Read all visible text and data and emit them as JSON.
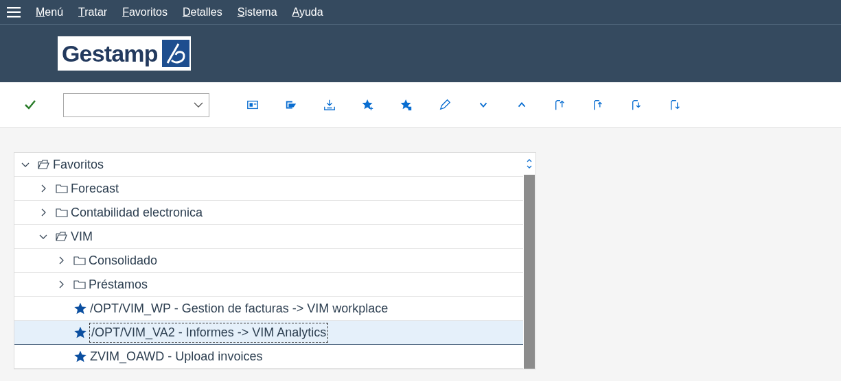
{
  "menu_bar": {
    "items": [
      {
        "label": "Menú"
      },
      {
        "label": "Tratar"
      },
      {
        "label": "Favoritos"
      },
      {
        "label": "Detalles"
      },
      {
        "label": "Sistema"
      },
      {
        "label": "Ayuda"
      }
    ]
  },
  "logo": {
    "text": "Gestamp"
  },
  "tree": [
    {
      "label": "Favoritos",
      "kind": "folder",
      "expanded": true,
      "selected": false,
      "children": [
        {
          "label": "Forecast",
          "kind": "folder",
          "expanded": false,
          "selected": false
        },
        {
          "label": "Contabilidad electronica",
          "kind": "folder",
          "expanded": false,
          "selected": false
        },
        {
          "label": "VIM",
          "kind": "folder",
          "expanded": true,
          "selected": false,
          "children": [
            {
              "label": "Consolidado",
              "kind": "folder",
              "expanded": false,
              "selected": false
            },
            {
              "label": "Préstamos",
              "kind": "folder",
              "expanded": false,
              "selected": false
            },
            {
              "label": "/OPT/VIM_WP - Gestion de facturas -> VIM workplace",
              "kind": "favorite",
              "selected": false
            },
            {
              "label": "/OPT/VIM_VA2 - Informes -> VIM Analytics",
              "kind": "favorite",
              "selected": true
            },
            {
              "label": "ZVIM_OAWD - Upload invoices",
              "kind": "favorite",
              "selected": false
            }
          ]
        }
      ]
    }
  ]
}
